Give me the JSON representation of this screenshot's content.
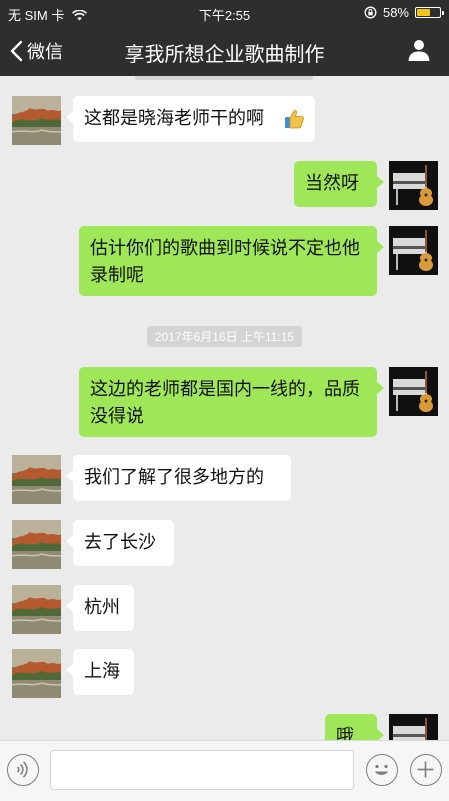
{
  "status": {
    "carrier": "无 SIM 卡",
    "time": "下午2:55",
    "battery": "58%",
    "battery_level": 0.58
  },
  "nav": {
    "back_label": "微信",
    "title": "享我所想企业歌曲制作"
  },
  "messages": [
    {
      "side": "left",
      "text": "这都是晓海老师干的啊"
    },
    {
      "side": "right",
      "text": "当然呀"
    },
    {
      "side": "right",
      "text": "估计你们的歌曲到时候说不定也他录制呢"
    },
    {
      "type": "time",
      "text": "2017年6月16日 上午11:15"
    },
    {
      "side": "right",
      "text": "这边的老师都是国内一线的，品质没得说"
    },
    {
      "side": "left",
      "text": "我们了解了很多地方的"
    },
    {
      "side": "left",
      "text": "去了长沙"
    },
    {
      "side": "left",
      "text": "杭州"
    },
    {
      "side": "left",
      "text": "上海"
    },
    {
      "side": "right",
      "text": "哦"
    }
  ],
  "input": {
    "placeholder": ""
  },
  "colors": {
    "nav_bg": "#2e2e2e",
    "sent_bubble": "#9fe658",
    "received_bubble": "#ffffff",
    "chat_bg": "#ebebeb"
  }
}
